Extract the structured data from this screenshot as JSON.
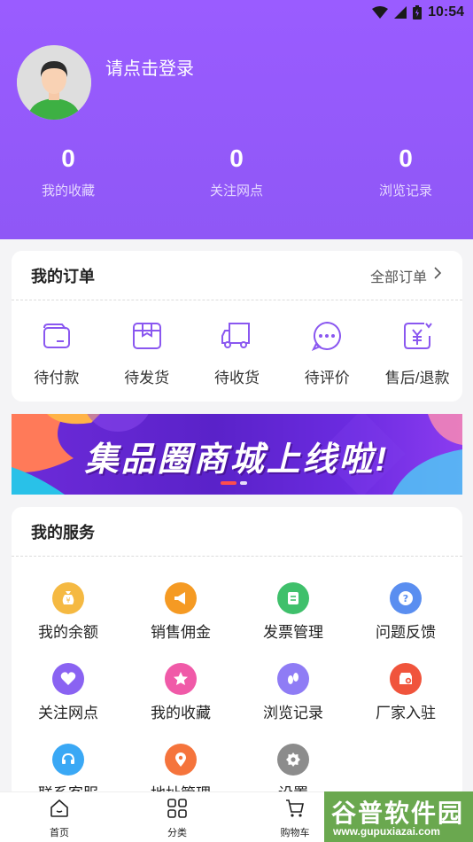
{
  "status_bar": {
    "time": "10:54"
  },
  "profile": {
    "login_text": "请点击登录"
  },
  "stats": [
    {
      "value": "0",
      "label": "我的收藏"
    },
    {
      "value": "0",
      "label": "关注网点"
    },
    {
      "value": "0",
      "label": "浏览记录"
    }
  ],
  "orders": {
    "title": "我的订单",
    "all_label": "全部订单",
    "items": [
      {
        "label": "待付款",
        "icon": "wallet-icon"
      },
      {
        "label": "待发货",
        "icon": "box-icon"
      },
      {
        "label": "待收货",
        "icon": "truck-icon"
      },
      {
        "label": "待评价",
        "icon": "comment-icon"
      },
      {
        "label": "售后/退款",
        "icon": "refund-icon"
      }
    ]
  },
  "banner": {
    "text": "集品圈商城上线啦!"
  },
  "services": {
    "title": "我的服务",
    "items": [
      {
        "label": "我的余额",
        "icon": "money-bag-icon",
        "color": "#f5b942"
      },
      {
        "label": "销售佣金",
        "icon": "megaphone-icon",
        "color": "#f59a23"
      },
      {
        "label": "发票管理",
        "icon": "invoice-icon",
        "color": "#3fc06b"
      },
      {
        "label": "问题反馈",
        "icon": "question-icon",
        "color": "#5a8ef0"
      },
      {
        "label": "关注网点",
        "icon": "heart-icon",
        "color": "#8a63f2"
      },
      {
        "label": "我的收藏",
        "icon": "star-icon",
        "color": "#f05aa8"
      },
      {
        "label": "浏览记录",
        "icon": "footprint-icon",
        "color": "#8f7cf5"
      },
      {
        "label": "厂家入驻",
        "icon": "store-add-icon",
        "color": "#f0543c"
      },
      {
        "label": "联系客服",
        "icon": "headset-icon",
        "color": "#3aa8f5"
      },
      {
        "label": "地址管理",
        "icon": "location-icon",
        "color": "#f5743c"
      },
      {
        "label": "设置",
        "icon": "settings-icon",
        "color": "#8c8c8c"
      }
    ]
  },
  "tabbar": [
    {
      "label": "首页",
      "icon": "home-icon"
    },
    {
      "label": "分类",
      "icon": "grid-icon"
    },
    {
      "label": "购物车",
      "icon": "cart-icon"
    }
  ],
  "watermark": {
    "main": "谷普软件园",
    "sub": "www.gupuxiazai.com"
  },
  "colors": {
    "accent": "#9a5cff",
    "icon_purple": "#8a57f0"
  }
}
